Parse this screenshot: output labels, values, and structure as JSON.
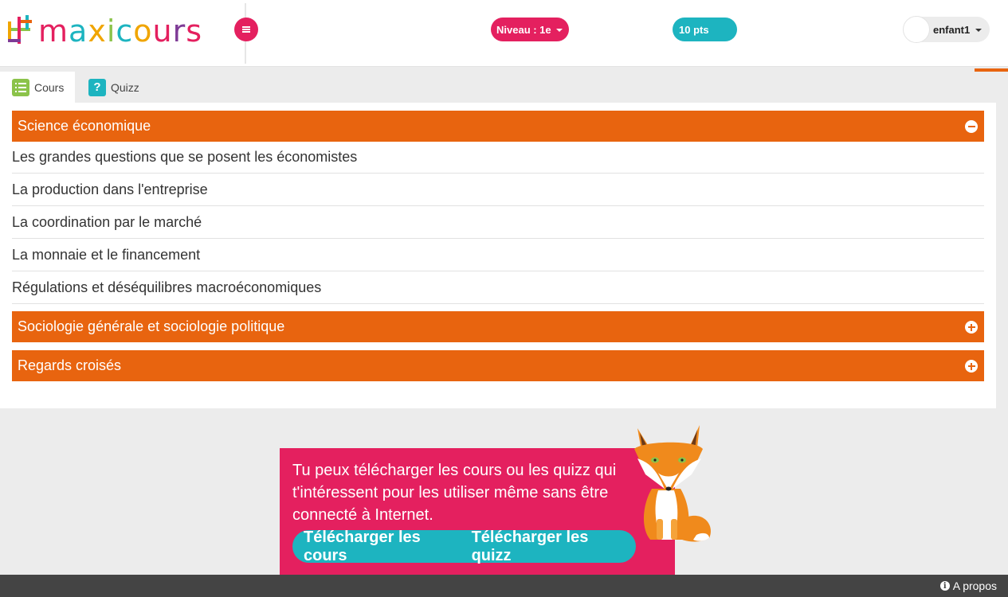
{
  "header": {
    "logo_text": "maxicours",
    "niveau_label": "Niveau : 1e",
    "points_label": "10 pts",
    "username": "enfant1"
  },
  "tabs": [
    {
      "label": "Cours",
      "icon": "list-icon",
      "active": true
    },
    {
      "label": "Quizz",
      "icon": "question-icon",
      "active": false
    }
  ],
  "sections": [
    {
      "title": "Science économique",
      "expanded": true,
      "items": [
        "Les grandes questions que se posent les économistes",
        "La production dans l'entreprise",
        "La coordination par le marché",
        "La monnaie et le financement",
        "Régulations et déséquilibres macroéconomiques"
      ]
    },
    {
      "title": "Sociologie générale et sociologie politique",
      "expanded": false
    },
    {
      "title": "Regards croisés",
      "expanded": false
    }
  ],
  "promo": {
    "text": "Tu peux télécharger les cours ou les quizz qui t'intéressent pour les utiliser même sans être connecté à Internet.",
    "download_courses": "Télécharger les cours",
    "download_quizzes": "Télécharger les quizz"
  },
  "footer": {
    "about_label": "A propos"
  },
  "colors": {
    "pink": "#e4205f",
    "teal": "#1db4c0",
    "orange": "#e8640f",
    "green": "#8bc34a",
    "footer": "#444444"
  }
}
